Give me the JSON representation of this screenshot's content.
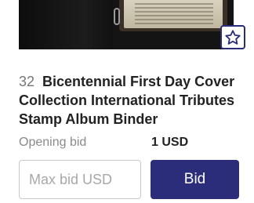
{
  "listing": {
    "lot_number": "32",
    "title": "Bicentennial First Day Cover Collection International Tributes Stamp Album Binder",
    "image_icon": "stamp-album-binder-photo",
    "watch_icon": "star-outline-icon"
  },
  "bidding": {
    "opening_label": "Opening bid",
    "opening_value": "1 USD",
    "max_bid_placeholder": "Max bid USD",
    "bid_label": "Bid"
  },
  "colors": {
    "accent": "#2b2c7a",
    "text_primary": "#222222",
    "text_muted": "#8a8a8a"
  }
}
